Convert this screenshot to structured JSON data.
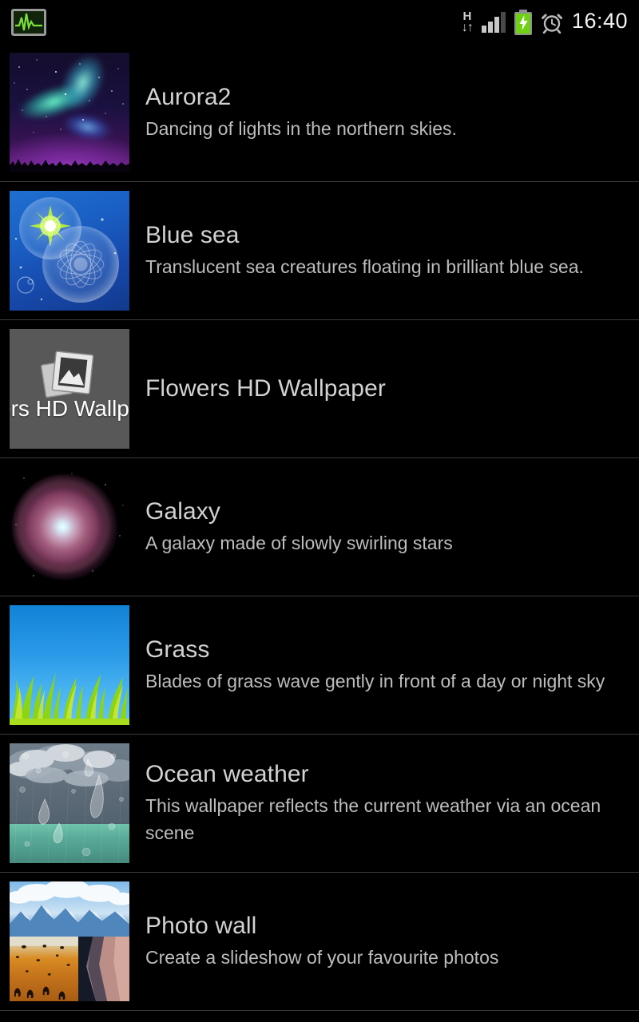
{
  "status_bar": {
    "app_icon": "pulse-monitor-icon",
    "data_type_label": "H",
    "data_arrows": "↓↑",
    "signal_icon": "signal-bars-icon",
    "signal_bars_total": 4,
    "signal_bars_active": 3,
    "battery_icon": "battery-charging-icon",
    "battery_color": "#6fd113",
    "alarm_icon": "alarm-clock-icon",
    "time": "16:40"
  },
  "wallpaper_list": {
    "items": [
      {
        "name": "Aurora2",
        "description": "Dancing of lights in the northern skies.",
        "thumb_name": "aurora2-thumbnail"
      },
      {
        "name": "Blue sea",
        "description": "Translucent sea creatures floating in brilliant blue sea.",
        "thumb_name": "blue-sea-thumbnail"
      },
      {
        "name": "Flowers HD Wallpaper",
        "description": "",
        "thumb_name": "flowers-hd-wallpaper-thumbnail",
        "thumb_overflow_text": "ers HD Wallp"
      },
      {
        "name": "Galaxy",
        "description": "A galaxy made of slowly swirling stars",
        "thumb_name": "galaxy-thumbnail"
      },
      {
        "name": "Grass",
        "description": "Blades of grass wave gently in front of a day or night sky",
        "thumb_name": "grass-thumbnail"
      },
      {
        "name": "Ocean weather",
        "description": "This wallpaper reflects the current weather via an ocean scene",
        "thumb_name": "ocean-weather-thumbnail"
      },
      {
        "name": "Photo wall",
        "description": "Create a slideshow of your favourite photos",
        "thumb_name": "photo-wall-thumbnail"
      }
    ]
  },
  "colors": {
    "background": "#000000",
    "title_text": "#d2d2d2",
    "subtitle_text": "#bdbdbd",
    "divider": "#3d3d3d",
    "status_time": "#f2f2f2"
  }
}
